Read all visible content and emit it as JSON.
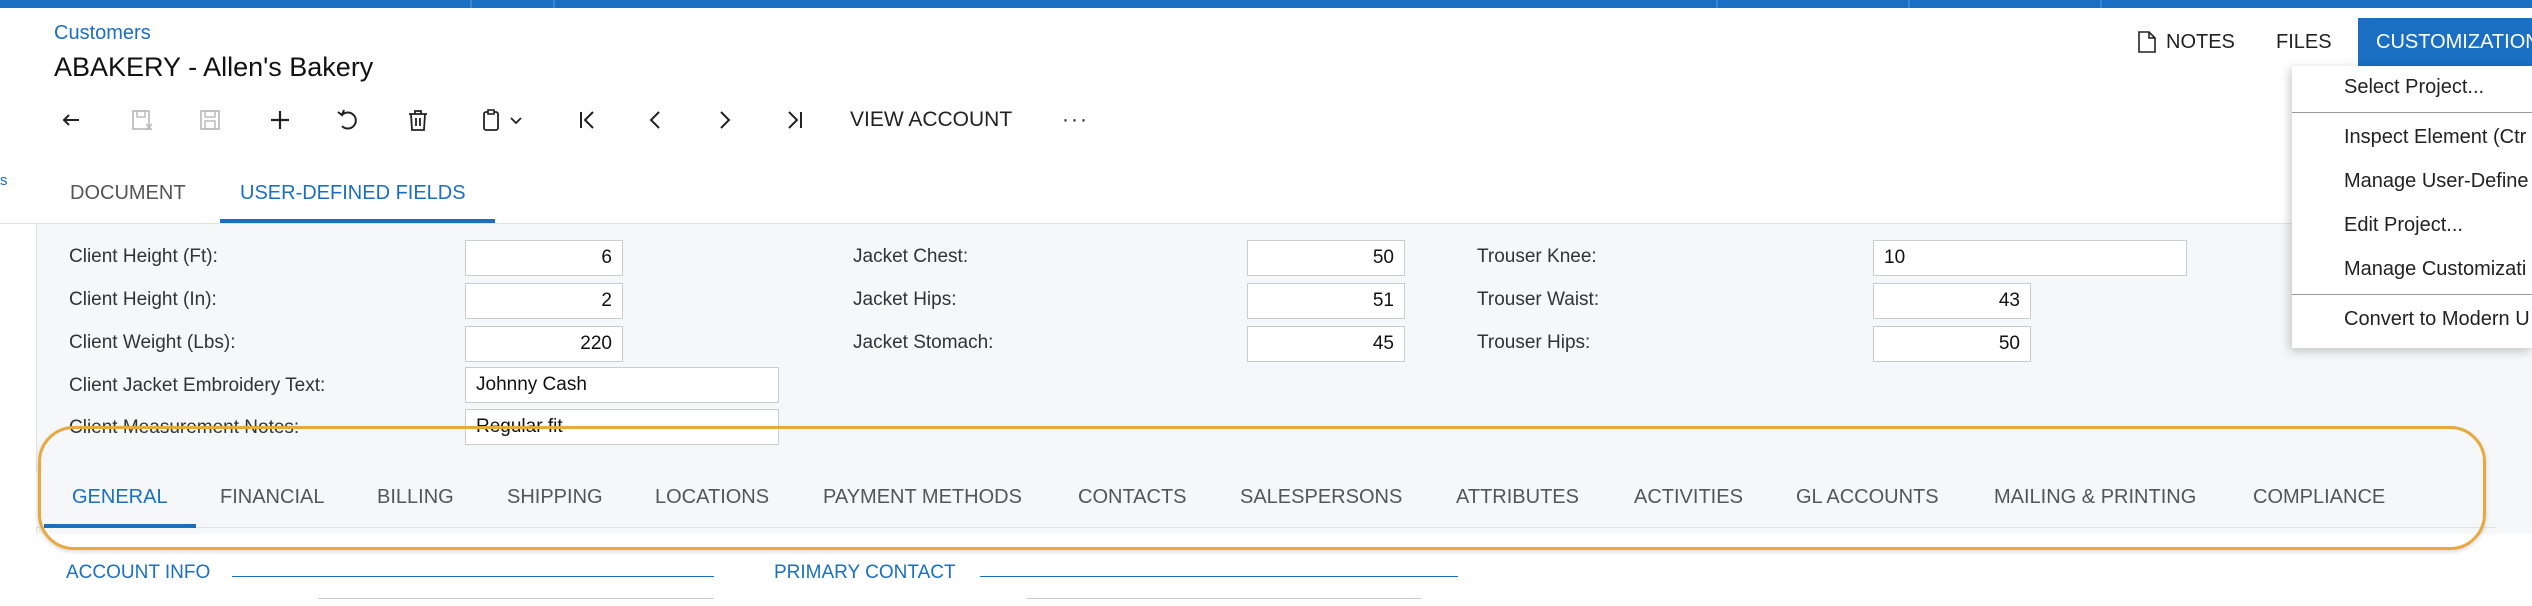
{
  "header": {
    "breadcrumb": "Customers",
    "title": "ABAKERY - Allen's Bakery",
    "left_fragment": "s"
  },
  "toolbar": {
    "view_account": "VIEW ACCOUNT",
    "more": "···"
  },
  "actions": {
    "notes": "NOTES",
    "files": "FILES",
    "customization": "CUSTOMIZATION"
  },
  "customization_menu": {
    "items": [
      "Select Project...",
      "Inspect Element (Ctr",
      "Manage User-Define",
      "Edit Project...",
      "Manage Customizati",
      "Convert to Modern U"
    ]
  },
  "form_tabs": {
    "document": "DOCUMENT",
    "user_defined_fields": "USER-DEFINED FIELDS"
  },
  "user_defined_fields": {
    "client_height_ft": {
      "label": "Client Height (Ft):",
      "value": "6"
    },
    "client_height_in": {
      "label": "Client Height (In):",
      "value": "2"
    },
    "client_weight_lbs": {
      "label": "Client Weight (Lbs):",
      "value": "220"
    },
    "client_jacket_embroidery": {
      "label": "Client Jacket Embroidery Text:",
      "value": "Johnny Cash"
    },
    "client_measurement_notes": {
      "label": "Client Measurement Notes:",
      "value": "Regular fit"
    },
    "jacket_chest": {
      "label": "Jacket Chest:",
      "value": "50"
    },
    "jacket_hips": {
      "label": "Jacket Hips:",
      "value": "51"
    },
    "jacket_stomach": {
      "label": "Jacket Stomach:",
      "value": "45"
    },
    "trouser_knee": {
      "label": "Trouser Knee:",
      "value": "10"
    },
    "trouser_waist": {
      "label": "Trouser Waist:",
      "value": "43"
    },
    "trouser_hips": {
      "label": "Trouser Hips:",
      "value": "50"
    }
  },
  "detail_tabs": [
    "GENERAL",
    "FINANCIAL",
    "BILLING",
    "SHIPPING",
    "LOCATIONS",
    "PAYMENT METHODS",
    "CONTACTS",
    "SALESPERSONS",
    "ATTRIBUTES",
    "ACTIVITIES",
    "GL ACCOUNTS",
    "MAILING & PRINTING",
    "COMPLIANCE"
  ],
  "sections": {
    "account_info": "ACCOUNT INFO",
    "primary_contact": "PRIMARY CONTACT"
  },
  "colors": {
    "accent": "#1a6fc2",
    "highlight": "#e8a83e"
  }
}
